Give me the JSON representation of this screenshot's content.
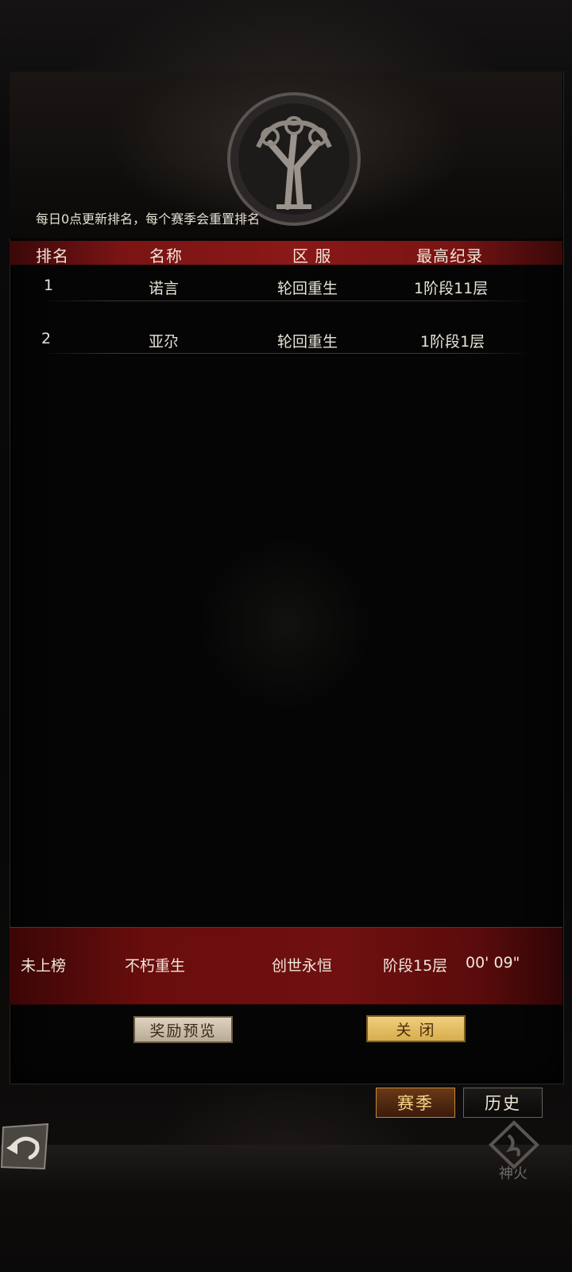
{
  "notice": "每日0点更新排名，每个赛季会重置排名",
  "table": {
    "headers": [
      "排名",
      "名称",
      "区 服",
      "最高纪录"
    ],
    "rows": [
      {
        "rank": "1",
        "name": "诺言",
        "server": "轮回重生",
        "record": "1阶段11层"
      },
      {
        "rank": "2",
        "name": "亚尕",
        "server": "轮回重生",
        "record": "1阶段1层"
      }
    ]
  },
  "self_row": {
    "rank": "未上榜",
    "name": "不朽重生",
    "server": "创世永恒",
    "record": "阶段15层",
    "time": "00' 09\""
  },
  "buttons": {
    "reward_preview": "奖励预览",
    "close": "关 闭"
  },
  "tabs": {
    "season": "赛季",
    "history": "历史"
  },
  "logo_text": "神火",
  "icons": {
    "emblem": "tree-emblem-icon",
    "back": "back-arrow-icon",
    "logo": "shenhuo-logo-icon"
  }
}
